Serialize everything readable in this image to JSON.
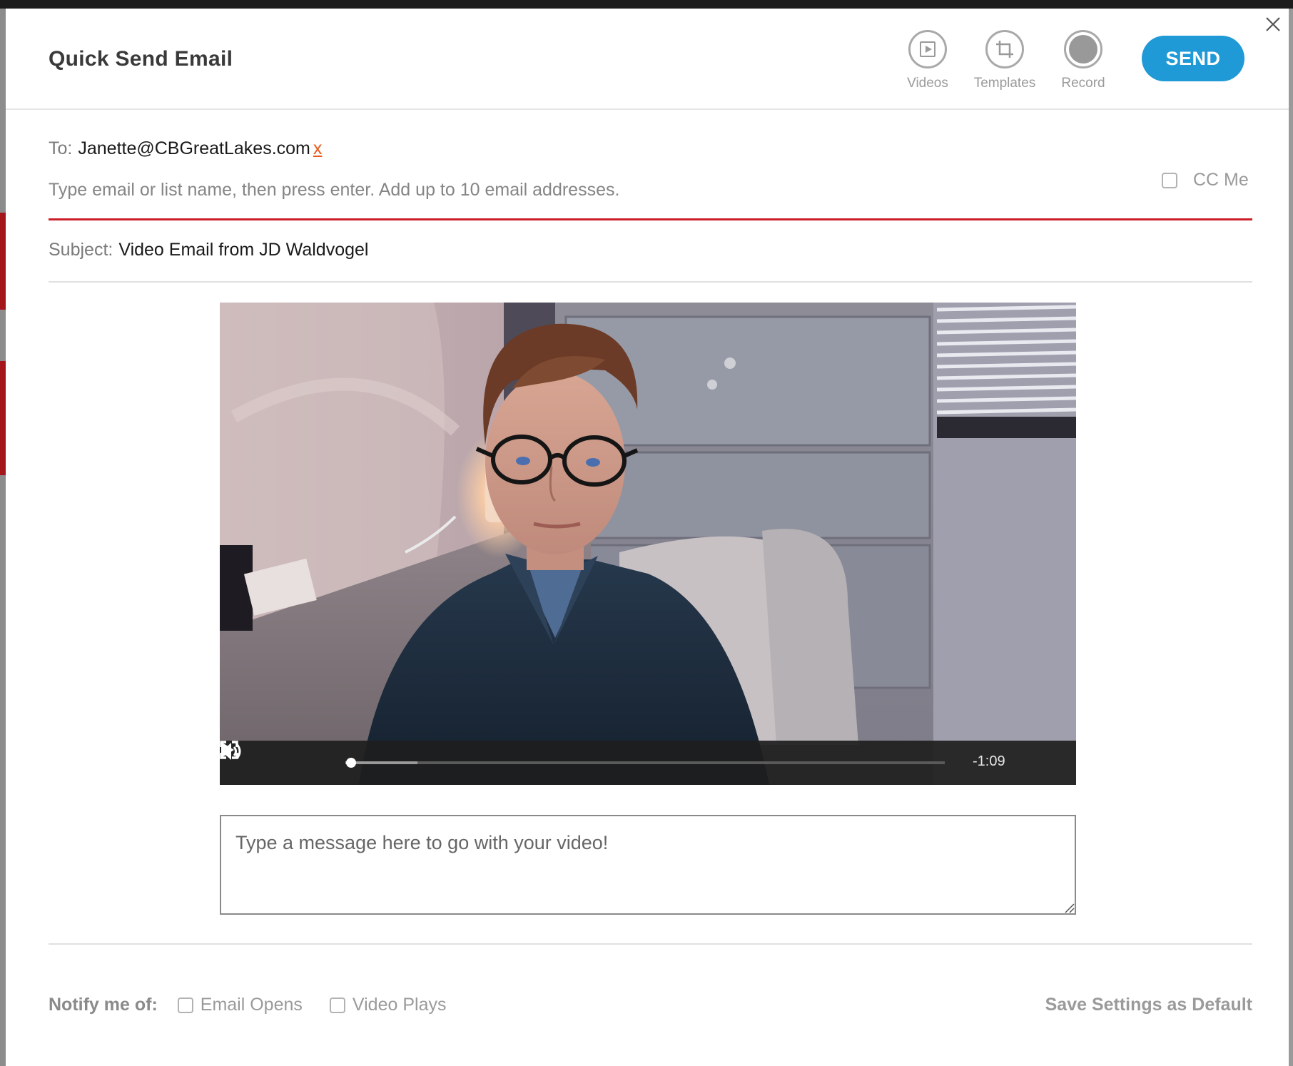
{
  "header": {
    "title": "Quick Send Email",
    "tools": {
      "videos": "Videos",
      "templates": "Templates",
      "record": "Record"
    },
    "send_label": "SEND"
  },
  "to": {
    "label": "To:",
    "recipient": "Janette@CBGreatLakes.com",
    "remove_label": "x",
    "placeholder": "Type email or list name, then press enter. Add up to 10 email addresses.",
    "cc_label": "CC Me"
  },
  "subject": {
    "label": "Subject:",
    "value": "Video Email from JD Waldvogel"
  },
  "video": {
    "time_remaining": "-1:09",
    "progress_fraction": 0.01,
    "buffered_fraction": 0.12
  },
  "message": {
    "placeholder": "Type a message here to go with your video!"
  },
  "footer": {
    "notify_label": "Notify me of:",
    "email_opens": "Email Opens",
    "video_plays": "Video Plays",
    "save_default": "Save Settings as Default"
  },
  "colors": {
    "accent": "#1f9ad6",
    "error_line": "#cc1f2a",
    "remove_link": "#e8581c"
  }
}
